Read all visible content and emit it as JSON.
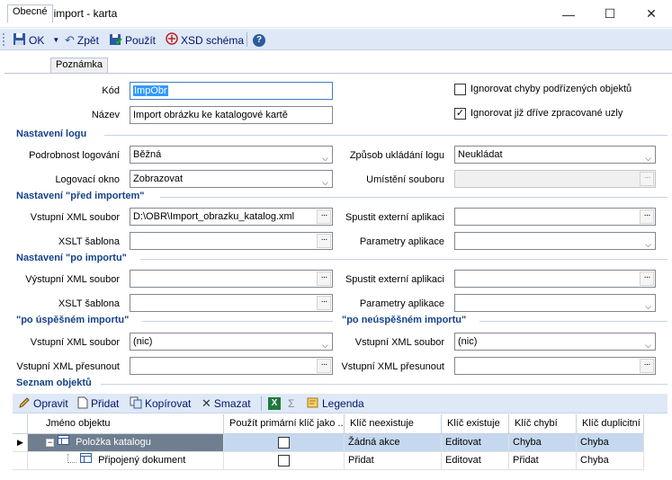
{
  "window": {
    "title": "XML import - karta"
  },
  "toolbar": {
    "ok": "OK",
    "back": "Zpět",
    "use": "Použít",
    "xsd": "XSD schéma"
  },
  "tabs": [
    {
      "label": "Obecné"
    },
    {
      "label": "Poznámka"
    }
  ],
  "general": {
    "code_label": "Kód",
    "code_value": "ImpObr",
    "name_label": "Název",
    "name_value": "Import obrázku ke katalogové kartě",
    "ignore_errors_label": "Ignorovat chyby podřízených objektů",
    "ignore_errors_checked": false,
    "ignore_processed_label": "Ignorovat již dříve zpracované uzly",
    "ignore_processed_checked": true
  },
  "log": {
    "section": "Nastavení logu",
    "detail_label": "Podrobnost logování",
    "detail_value": "Běžná",
    "window_label": "Logovací okno",
    "window_value": "Zobrazovat",
    "save_mode_label": "Způsob ukládání logu",
    "save_mode_value": "Neukládat",
    "location_label": "Umístění souboru",
    "location_value": ""
  },
  "before": {
    "section": "Nastavení \"před importem\"",
    "xml_label": "Vstupní XML soubor",
    "xml_value": "D:\\OBR\\Import_obrazku_katalog.xml",
    "xslt_label": "XSLT šablona",
    "xslt_value": "",
    "ext_label": "Spustit externí aplikaci",
    "ext_value": "",
    "params_label": "Parametry aplikace",
    "params_value": ""
  },
  "after": {
    "section": "Nastavení \"po importu\"",
    "xml_label": "Výstupní XML soubor",
    "xml_value": "",
    "xslt_label": "XSLT šablona",
    "xslt_value": "",
    "ext_label": "Spustit externí aplikaci",
    "ext_value": "",
    "params_label": "Parametry aplikace",
    "params_value": ""
  },
  "success": {
    "section": "\"po úspěšném importu\"",
    "xml_label": "Vstupní XML soubor",
    "xml_value": "(nic)",
    "move_label": "Vstupní XML přesunout",
    "move_value": ""
  },
  "failure": {
    "section": "\"po neúspěšném importu\"",
    "xml_label": "Vstupní XML soubor",
    "xml_value": "(nic)",
    "move_label": "Vstupní XML přesunout",
    "move_value": ""
  },
  "objects": {
    "section": "Seznam objektů",
    "toolbar": {
      "edit": "Opravit",
      "add": "Přidat",
      "copy": "Kopírovat",
      "delete": "Smazat",
      "sigma": "Σ",
      "legend": "Legenda"
    },
    "columns": [
      "Jméno objektu",
      "Použít primární klíč jako ...",
      "Klíč neexistuje",
      "Klíč existuje",
      "Klíč chybí",
      "Klíč duplicitní"
    ],
    "rows": [
      {
        "name": "Položka katalogu",
        "use_pk": false,
        "not_exists": "Žádná akce",
        "exists": "Editovat",
        "missing": "Chyba",
        "duplicate": "Chyba"
      },
      {
        "name": "Připojený dokument",
        "use_pk": false,
        "not_exists": "Přidat",
        "exists": "Editovat",
        "missing": "Přidat",
        "duplicate": "Chyba"
      }
    ]
  }
}
